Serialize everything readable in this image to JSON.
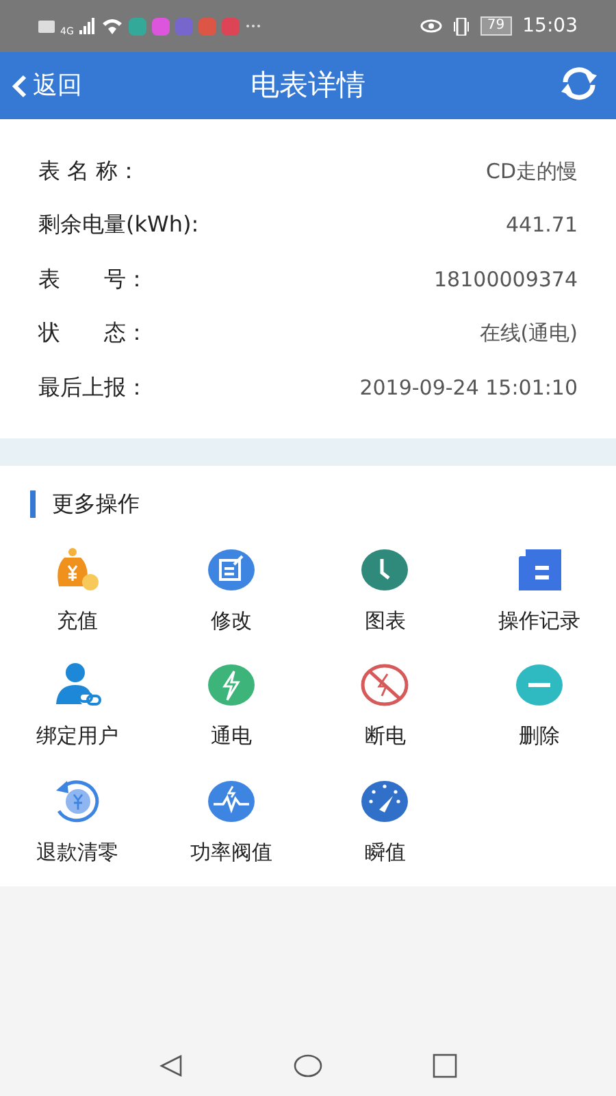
{
  "status_bar": {
    "network": "4G",
    "battery": "79",
    "time": "15:03"
  },
  "header": {
    "back": "返回",
    "title": "电表详情"
  },
  "details": [
    {
      "label": "表 名 称：",
      "value": "CD走的慢"
    },
    {
      "label": "剩余电量(kWh):",
      "value": "441.71"
    },
    {
      "label": "表　　号：",
      "value": "18100009374"
    },
    {
      "label": "状　　态：",
      "value": "在线(通电)"
    },
    {
      "label": "最后上报：",
      "value": "2019-09-24 15:01:10"
    }
  ],
  "section_title": "更多操作",
  "actions": [
    {
      "kind": "recharge",
      "label": "充值"
    },
    {
      "kind": "edit",
      "label": "修改"
    },
    {
      "kind": "chart",
      "label": "图表"
    },
    {
      "kind": "log",
      "label": "操作记录"
    },
    {
      "kind": "bind",
      "label": "绑定用户"
    },
    {
      "kind": "power_on",
      "label": "通电"
    },
    {
      "kind": "power_off",
      "label": "断电"
    },
    {
      "kind": "delete",
      "label": "删除"
    },
    {
      "kind": "refund",
      "label": "退款清零"
    },
    {
      "kind": "threshold",
      "label": "功率阀值"
    },
    {
      "kind": "instant",
      "label": "瞬值"
    }
  ]
}
